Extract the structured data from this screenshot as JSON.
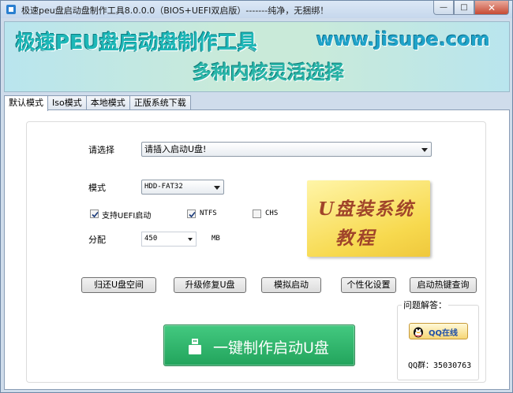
{
  "window": {
    "title": "极速peu盘启动盘制作工具8.0.0.0（BIOS+UEFI双启版）-------纯净，无捆绑！",
    "minimize_glyph": "—",
    "maximize_glyph": "□",
    "close_glyph": "✕"
  },
  "banner": {
    "title": "极速PEU盘启动盘制作工具",
    "url": "www.jisupe.com",
    "subtitle": "多种内核灵活选择"
  },
  "tabs": [
    {
      "label": "默认模式",
      "active": true
    },
    {
      "label": "Iso模式",
      "active": false
    },
    {
      "label": "本地模式",
      "active": false
    },
    {
      "label": "正版系统下载",
      "active": false
    }
  ],
  "form": {
    "select_label": "请选择",
    "select_value": "请插入启动U盘!",
    "mode_label": "模式",
    "mode_value": "HDD-FAT32",
    "uefi_label": "支持UEFI启动",
    "uefi_checked": true,
    "ntfs_label": "NTFS",
    "ntfs_checked": true,
    "chs_label": "CHS",
    "chs_checked": false,
    "alloc_label": "分配",
    "alloc_value": "450",
    "alloc_unit": "MB"
  },
  "tutorial": {
    "line1": "U盘装系统",
    "line2": "教程"
  },
  "actions": [
    {
      "label": "归还U盘空间"
    },
    {
      "label": "升级修复U盘"
    },
    {
      "label": "模拟启动"
    },
    {
      "label": "个性化设置"
    },
    {
      "label": "启动热键查询"
    }
  ],
  "main_button": {
    "label": "一键制作启动U盘"
  },
  "qq": {
    "title": "问题解答：",
    "button_label": "QQ在线",
    "group": "QQ群：35030763"
  },
  "colors": {
    "accent_green": "#22a45c",
    "banner_teal": "#1db7b7",
    "note_yellow": "#f7d94e"
  }
}
